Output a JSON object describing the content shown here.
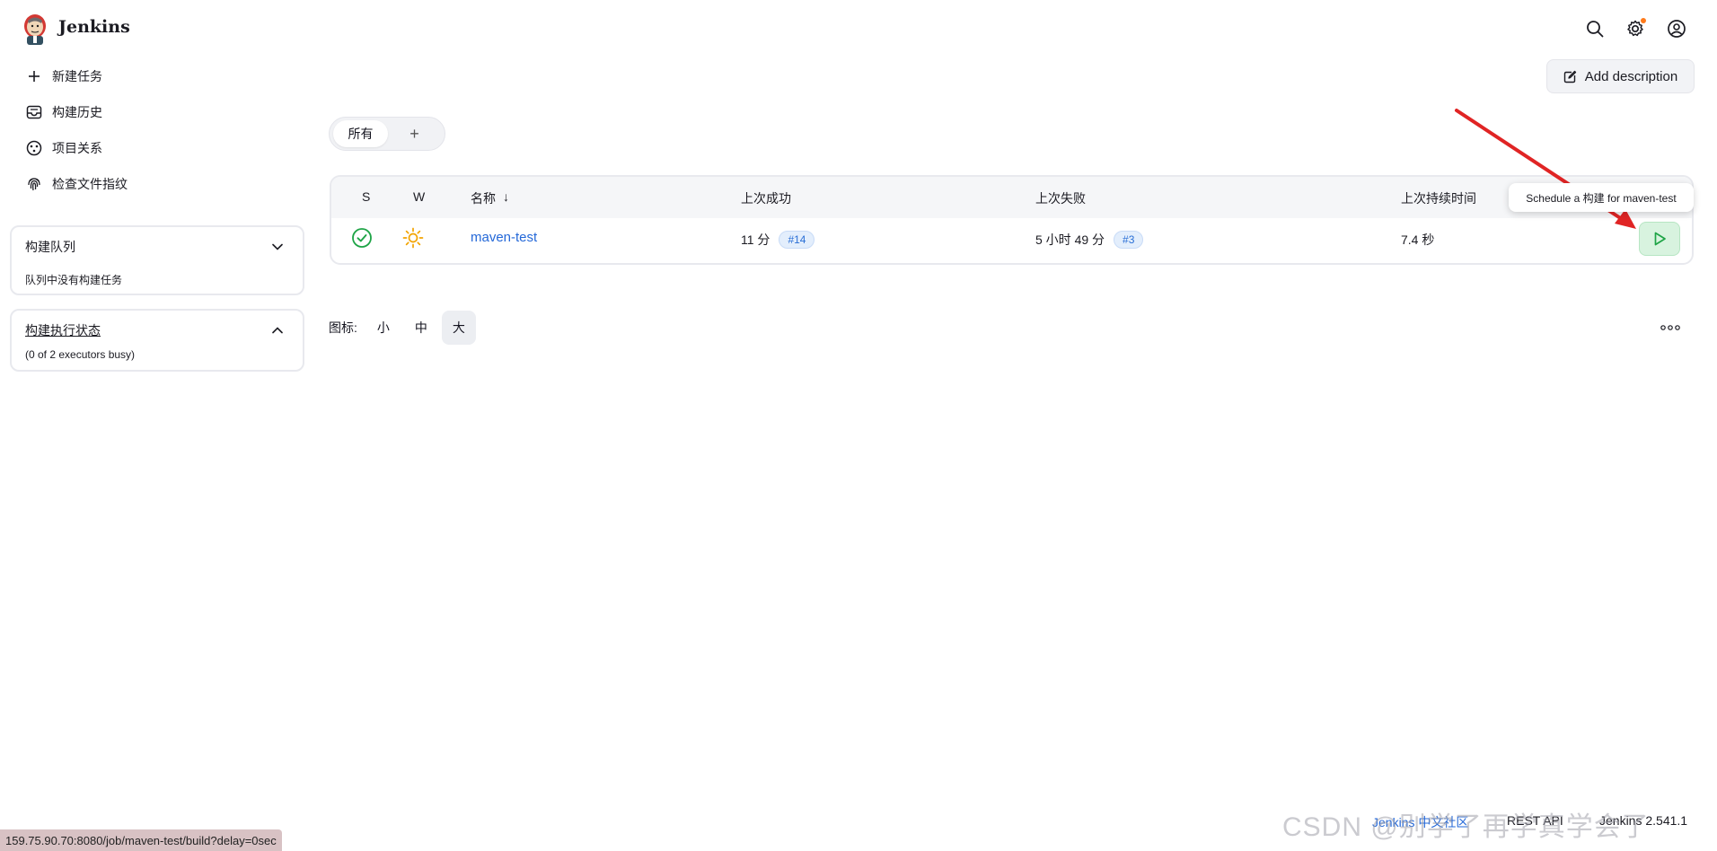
{
  "header": {
    "brand": "Jenkins",
    "icons": [
      "search-icon",
      "settings-icon",
      "user-icon"
    ]
  },
  "sidebar": {
    "tasks": [
      {
        "label": "新建任务",
        "icon": "plus-icon"
      },
      {
        "label": "构建历史",
        "icon": "inbox-icon"
      },
      {
        "label": "项目关系",
        "icon": "relationship-icon"
      },
      {
        "label": "检查文件指纹",
        "icon": "fingerprint-icon"
      }
    ],
    "build_queue": {
      "title": "构建队列",
      "body": "队列中没有构建任务"
    },
    "executors": {
      "title": "构建执行状态",
      "body": "(0 of 2 executors busy)"
    }
  },
  "main": {
    "add_description": "Add description",
    "tabs": {
      "active": "所有",
      "add": "+"
    },
    "table": {
      "columns": {
        "s": "S",
        "w": "W",
        "name": "名称",
        "sort_arrow": "↓",
        "last_success": "上次成功",
        "last_failure": "上次失败",
        "last_duration": "上次持续时间"
      },
      "rows": [
        {
          "name": "maven-test",
          "status": "success",
          "weather": "sunny",
          "last_success_time": "11 分",
          "last_success_build": "#14",
          "last_failure_time": "5 小时 49 分",
          "last_failure_build": "#3",
          "last_duration": "7.4 秒"
        }
      ]
    },
    "tooltip": "Schedule a 构建 for maven-test",
    "icon_size": {
      "label": "图标:",
      "options": [
        "小",
        "中",
        "大"
      ],
      "selected": "大"
    }
  },
  "footer": {
    "community": "Jenkins 中文社区",
    "rest_api": "REST API",
    "version": "Jenkins 2.541.1"
  },
  "status_bar_url": "159.75.90.70:8080/job/maven-test/build?delay=0sec",
  "watermark": "CSDN @别学了再学真学会了",
  "colors": {
    "accent_link": "#2468d8",
    "success": "#1ea446",
    "weather": "#f2a300",
    "arrow": "#e02424"
  }
}
